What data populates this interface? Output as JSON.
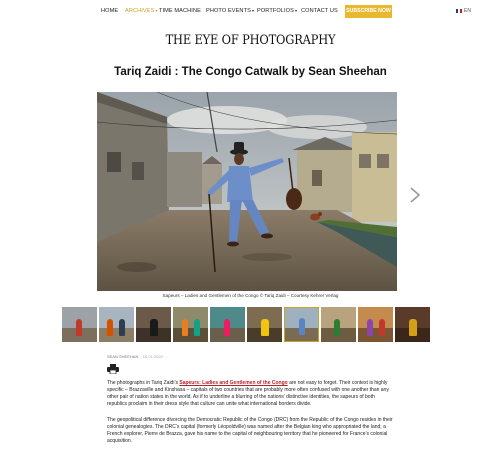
{
  "nav": {
    "items": [
      {
        "label": "HOME"
      },
      {
        "label": "ARCHIVES"
      },
      {
        "label": "TIME MACHINE"
      },
      {
        "label": "PHOTO EVENTS"
      },
      {
        "label": "PORTFOLIOS"
      },
      {
        "label": "CONTACT US"
      }
    ],
    "caret": "▾",
    "subscribe": "SUBSCRIBE NOW",
    "lang": "EN"
  },
  "site": {
    "logo": "THE EYE OF PHOTOGRAPHY"
  },
  "article": {
    "title": "Tariq Zaidi : The Congo Catwalk by Sean Sheehan",
    "hero_caption": "Sapeurs – Ladies and Gentlemen of the Congo © Tariq Zaidi – Courtesy Kehrer Verlag",
    "author": "SEAN SHEEHAN",
    "date": "· 16.01.2020 · · ·",
    "p1_before": "The photographs in Tariq Zaidi’s ",
    "p1_link": "Sapeurs: Ladies and Gentlemen of the Congo",
    "p1_after": " are not easy to forget. Their context is highly specific – Brazzaville and Kinshasa – capitals of two countries that are probably more often confused with one another than any other pair of nation states in the world. As if to underline a blurring of the nations’ distinctive identities, the sapeurs of both republics proclaim in their dress style that culture can unite what international borders divide.",
    "p2": "The geopolitical difference divorcing the Democratic Republic of the Congo (DRC) from the Republic of the Congo resides in their colonial genealogies. The DRC’s capital (formerly Léopoldville) was named after the Belgian king who appropriated the land; a French explorer, Pierre de Brazza, gave his name to the capital of neighbouring territory that he pioneered for France’s colonial acquisition."
  },
  "colors": {
    "accent": "#c9a227",
    "subscribe_bg": "#e8b92f",
    "link": "#b8232a"
  },
  "icons": {
    "next": "chevron-right-icon",
    "print": "printer-icon",
    "flag": "french-flag-icon"
  }
}
